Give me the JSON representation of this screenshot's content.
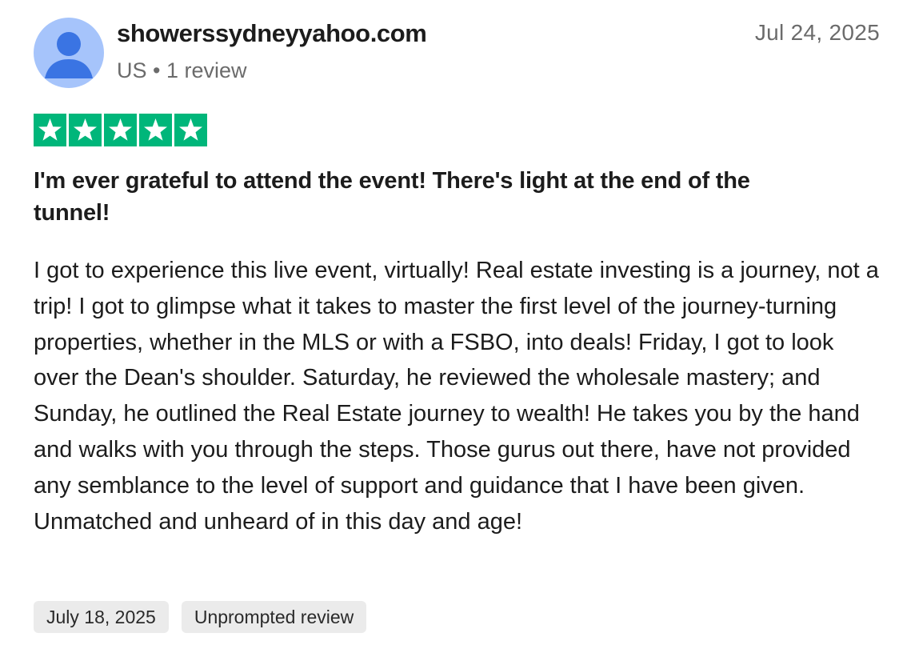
{
  "reviewer": {
    "name": "showerssydneyyahoo.com",
    "meta": "US • 1 review",
    "avatar_icon": "user-avatar-icon"
  },
  "review": {
    "date": "Jul 24, 2025",
    "rating": 5,
    "rating_max": 5,
    "star_color": "#00b67a",
    "title": "I'm ever grateful to attend the event! There's light at the end of the tunnel!",
    "body": "I got to experience this live event, virtually! Real estate investing is a journey, not a trip! I got to glimpse what it takes to master the first level of the journey-turning properties, whether in the MLS or with a FSBO, into deals! Friday, I got to look over the Dean's shoulder. Saturday, he reviewed the wholesale mastery; and Sunday, he outlined the Real Estate journey to wealth! He takes you by the hand and walks with you through the steps. Those gurus out there, have not provided any semblance to the level of support and guidance that I have been given. Unmatched and unheard of in this day and age!"
  },
  "tags": {
    "experience_date": "July 18, 2025",
    "unprompted": "Unprompted review"
  }
}
